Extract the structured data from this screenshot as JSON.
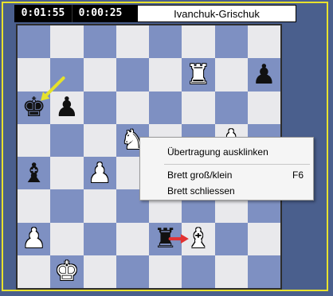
{
  "header": {
    "clock_white": "0:01:55",
    "clock_black": "0:00:25",
    "title": "Ivanchuk-Grischuk"
  },
  "board": {
    "orientation": "white-bottom",
    "light_color": "#e9e9ec",
    "dark_color": "#7e90c2",
    "pieces": [
      {
        "square": "f7",
        "piece": "R",
        "color": "white",
        "symbol": "♜",
        "name": "white-rook"
      },
      {
        "square": "h7",
        "piece": "p",
        "color": "black",
        "symbol": "♟",
        "name": "black-pawn"
      },
      {
        "square": "a6",
        "piece": "k",
        "color": "black",
        "symbol": "♚",
        "name": "black-king"
      },
      {
        "square": "b6",
        "piece": "p",
        "color": "black",
        "symbol": "♟",
        "name": "black-pawn"
      },
      {
        "square": "d5",
        "piece": "N",
        "color": "white",
        "symbol": "♞",
        "name": "white-knight"
      },
      {
        "square": "g5",
        "piece": "P",
        "color": "white",
        "symbol": "♟",
        "name": "white-pawn"
      },
      {
        "square": "a4",
        "piece": "b",
        "color": "black",
        "symbol": "♝",
        "name": "black-bishop"
      },
      {
        "square": "c4",
        "piece": "P",
        "color": "white",
        "symbol": "♟",
        "name": "white-pawn"
      },
      {
        "square": "a2",
        "piece": "P",
        "color": "white",
        "symbol": "♟",
        "name": "white-pawn"
      },
      {
        "square": "e2",
        "piece": "r",
        "color": "black",
        "symbol": "♜",
        "name": "black-rook"
      },
      {
        "square": "f2",
        "piece": "B",
        "color": "white",
        "symbol": "♝",
        "name": "white-bishop"
      },
      {
        "square": "b1",
        "piece": "K",
        "color": "white",
        "symbol": "♚",
        "name": "white-king"
      }
    ],
    "arrows": [
      {
        "from": "b7",
        "to": "a6",
        "color": "#e6e22a"
      },
      {
        "from": "e2",
        "to": "f2",
        "color": "#e23232"
      }
    ]
  },
  "context_menu": {
    "items": [
      {
        "label": "Übertragung ausklinken",
        "shortcut": ""
      },
      {
        "label": "Brett groß/klein",
        "shortcut": "F6"
      },
      {
        "label": "Brett schliessen",
        "shortcut": ""
      }
    ]
  },
  "colors": {
    "background": "#4a5f8d",
    "frame": "#e9e22c"
  }
}
